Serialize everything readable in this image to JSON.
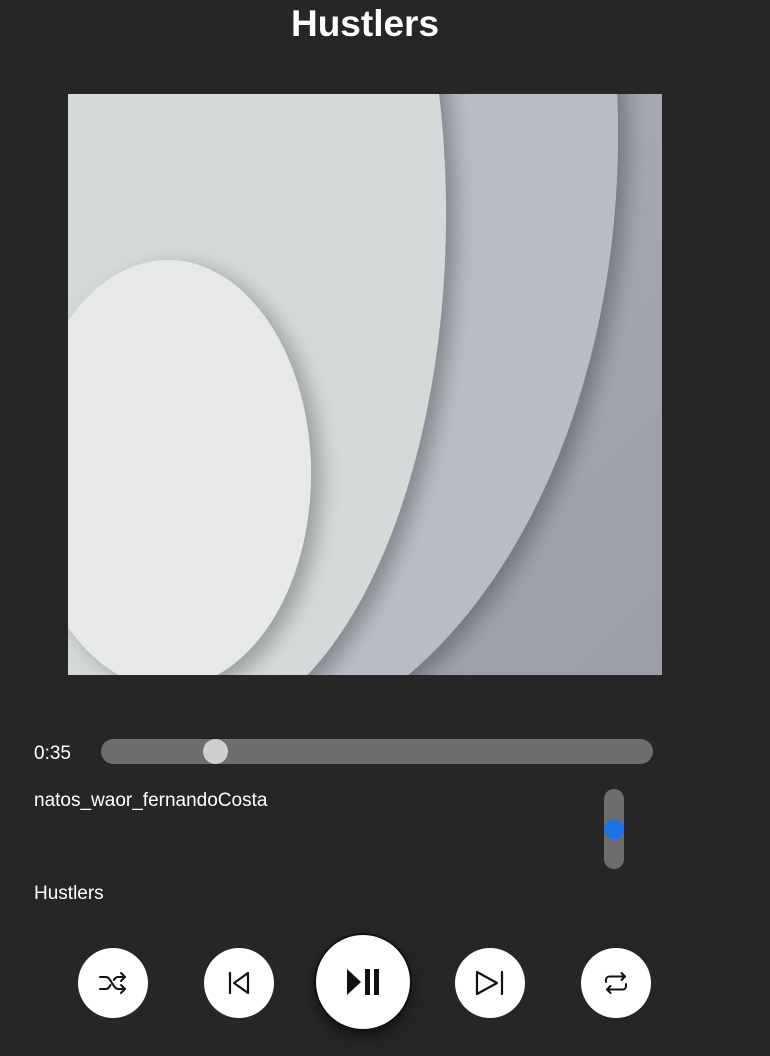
{
  "header": {
    "title": "Hustlers"
  },
  "player": {
    "current_time": "0:35",
    "progress_fraction": 0.193,
    "artist": "natos_waor_fernandoCosta",
    "song_title": "Hustlers",
    "volume_fraction": 0.5
  },
  "controls": [
    {
      "name": "shuffle-button",
      "icon": "shuffle-icon"
    },
    {
      "name": "previous-button",
      "icon": "skip-previous-icon"
    },
    {
      "name": "play-pause-button",
      "icon": "play-pause-icon"
    },
    {
      "name": "next-button",
      "icon": "skip-next-icon"
    },
    {
      "name": "repeat-button",
      "icon": "repeat-icon"
    }
  ],
  "colors": {
    "background": "#262626",
    "track": "#6d6d6d",
    "progress_thumb": "#cfcfcf",
    "volume_thumb": "#1a73e8",
    "button": "#ffffff"
  }
}
